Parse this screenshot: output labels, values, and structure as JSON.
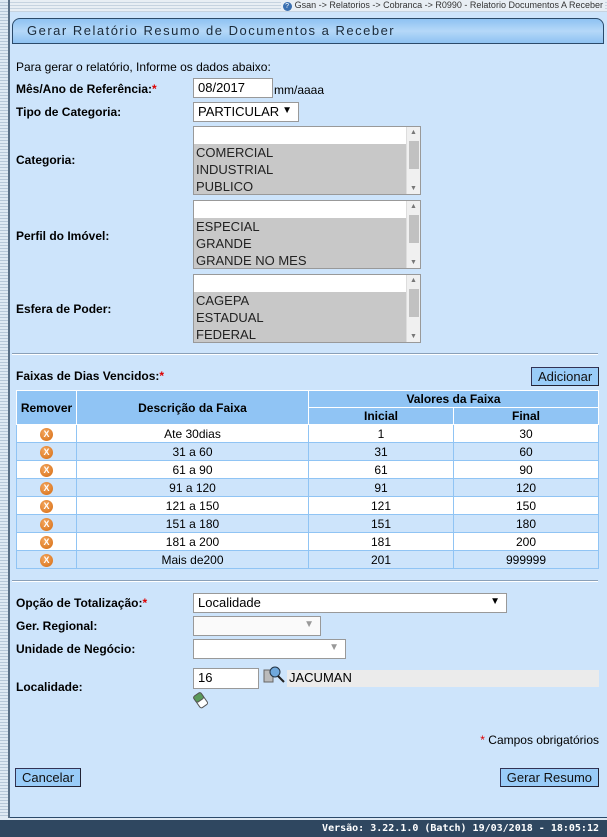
{
  "breadcrumb": "Gsan -> Relatorios -> Cobranca -> R0990 - Relatorio Documentos A Receber",
  "title": "Gerar Relatório Resumo de Documentos a Receber",
  "intro": "Para gerar o relatório, Informe os dados abaixo:",
  "mes_ano": {
    "label": "Mês/Ano de Referência:",
    "required": "*",
    "value": "08/2017",
    "hint": "mm/aaaa"
  },
  "tipo_categoria": {
    "label": "Tipo de Categoria:",
    "value": "PARTICULAR"
  },
  "categoria": {
    "label": "Categoria:",
    "options": [
      "",
      "COMERCIAL",
      "INDUSTRIAL",
      "PUBLICO"
    ]
  },
  "perfil": {
    "label": "Perfil do Imóvel:",
    "options": [
      "",
      "ESPECIAL",
      "GRANDE",
      "GRANDE NO MES"
    ]
  },
  "esfera": {
    "label": "Esfera de Poder:",
    "options": [
      "",
      "CAGEPA",
      "ESTADUAL",
      "FEDERAL"
    ]
  },
  "faixas": {
    "label": "Faixas de Dias Vencidos:",
    "required": "*",
    "add_label": "Adicionar",
    "headers": {
      "remover": "Remover",
      "descricao": "Descrição da Faixa",
      "valores": "Valores da Faixa",
      "inicial": "Inicial",
      "final": "Final"
    },
    "rows": [
      {
        "descricao": "Ate 30dias",
        "inicial": "1",
        "final": "30"
      },
      {
        "descricao": "31 a 60",
        "inicial": "31",
        "final": "60"
      },
      {
        "descricao": "61 a 90",
        "inicial": "61",
        "final": "90"
      },
      {
        "descricao": "91 a 120",
        "inicial": "91",
        "final": "120"
      },
      {
        "descricao": "121 a 150",
        "inicial": "121",
        "final": "150"
      },
      {
        "descricao": "151 a 180",
        "inicial": "151",
        "final": "180"
      },
      {
        "descricao": "181 a 200",
        "inicial": "181",
        "final": "200"
      },
      {
        "descricao": "Mais de200",
        "inicial": "201",
        "final": "999999"
      }
    ]
  },
  "totalizacao": {
    "label": "Opção de Totalização:",
    "required": "*",
    "value": "Localidade"
  },
  "ger_regional": {
    "label": "Ger. Regional:",
    "value": ""
  },
  "unidade": {
    "label": "Unidade de Negócio:",
    "value": ""
  },
  "localidade": {
    "label": "Localidade:",
    "code": "16",
    "name": "JACUMAN"
  },
  "required_note": {
    "star": "*",
    "text": " Campos obrigatórios"
  },
  "buttons": {
    "cancel": "Cancelar",
    "submit": "Gerar Resumo"
  },
  "footer": "Versão: 3.22.1.0 (Batch) 19/03/2018 - 18:05:12"
}
